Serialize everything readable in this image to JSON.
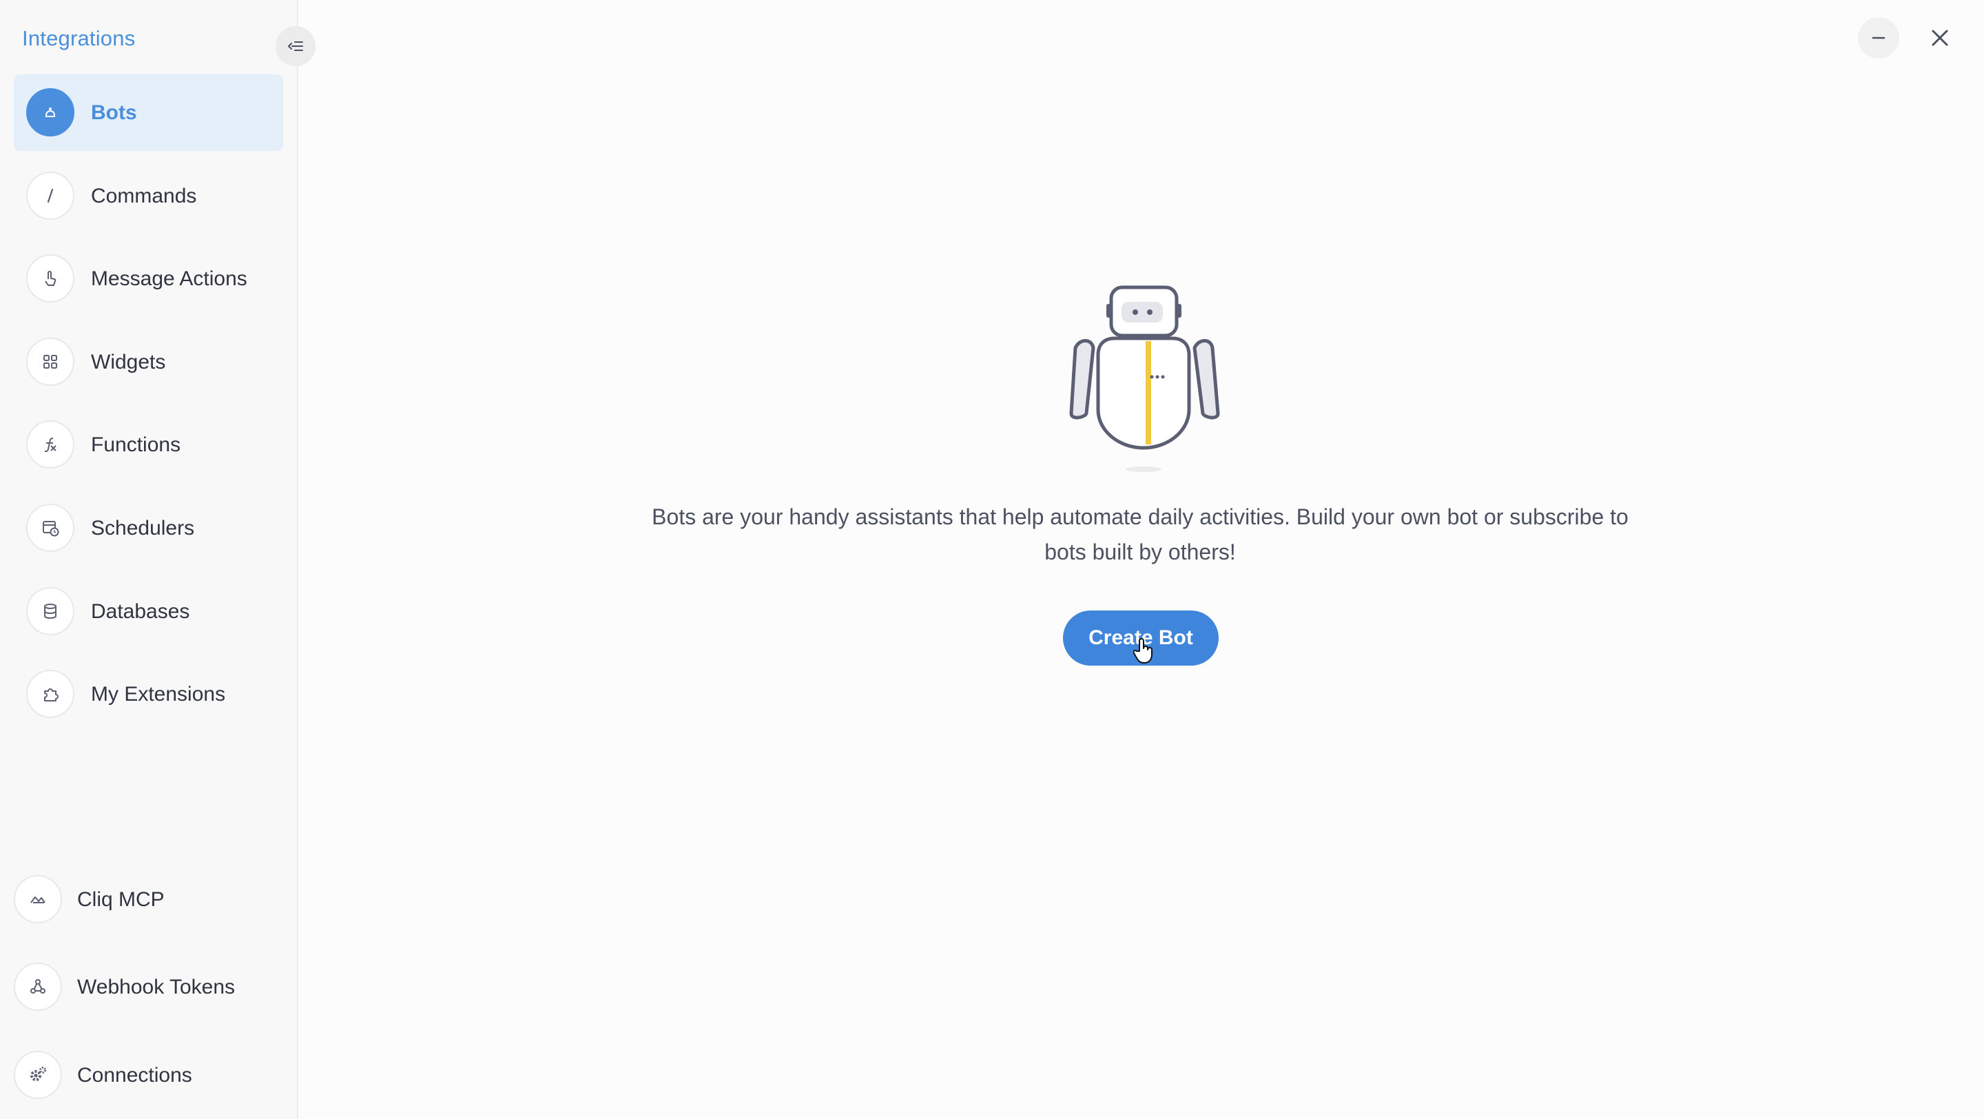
{
  "sidebar": {
    "title": "Integrations",
    "collapse_icon": "collapse-arrow-icon",
    "items": [
      {
        "label": "Bots",
        "icon": "bot-icon",
        "active": true
      },
      {
        "label": "Commands",
        "icon": "slash-icon"
      },
      {
        "label": "Message Actions",
        "icon": "touch-icon"
      },
      {
        "label": "Widgets",
        "icon": "grid-icon"
      },
      {
        "label": "Functions",
        "icon": "function-icon"
      },
      {
        "label": "Schedulers",
        "icon": "calendar-clock-icon"
      },
      {
        "label": "Databases",
        "icon": "database-icon"
      },
      {
        "label": "My Extensions",
        "icon": "puzzle-icon"
      }
    ],
    "bottom_items": [
      {
        "label": "Cliq MCP",
        "icon": "mcp-icon"
      },
      {
        "label": "Webhook Tokens",
        "icon": "webhook-icon"
      },
      {
        "label": "Connections",
        "icon": "gear-icon"
      }
    ]
  },
  "main": {
    "description": "Bots are your handy assistants that help automate daily activities. Build your own bot or subscribe to bots built by others!",
    "create_button_label": "Create Bot"
  },
  "window": {
    "minimize_icon": "minimize-icon",
    "close_icon": "close-icon"
  },
  "colors": {
    "accent": "#4a8fdd",
    "button": "#3f85dc",
    "active_bg": "#e5effa"
  }
}
